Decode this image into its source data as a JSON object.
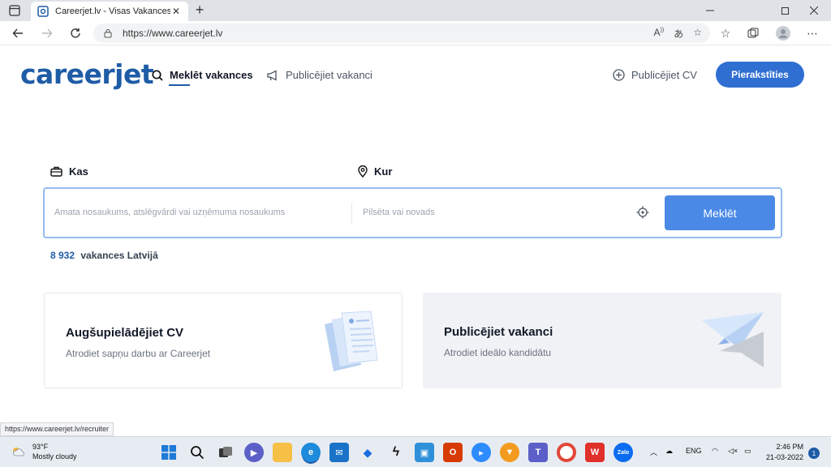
{
  "browser": {
    "tab_title": "Careerjet.lv - Visas Vakances Latvijā",
    "url": "https://www.careerjet.lv",
    "close_glyph": "✕",
    "newtab_glyph": "+"
  },
  "site": {
    "logo": "careerjet",
    "nav": {
      "search_jobs": "Meklēt vakances",
      "post_job": "Publicējiet vakanci",
      "post_cv": "Publicējiet CV",
      "signup": "Pierakstīties"
    },
    "search": {
      "what_label": "Kas",
      "where_label": "Kur",
      "what_placeholder": "Amata nosaukums, atslēgvārdi vai uzņēmuma nosaukums",
      "where_placeholder": "Pilsēta vai novads",
      "button": "Meklēt"
    },
    "count": {
      "number": "8 932",
      "text": "vakances Latvijā"
    },
    "cards": [
      {
        "title": "Augšupielādējiet CV",
        "subtitle": "Atrodiet sapņu darbu ar Careerjet"
      },
      {
        "title": "Publicējiet vakanci",
        "subtitle": "Atrodiet ideālo kandidātu"
      }
    ]
  },
  "status_url": "https://www.careerjet.lv/recruiter",
  "taskbar": {
    "temp": "93°F",
    "weather": "Mostly cloudy",
    "lang": "ENG",
    "time": "2:46 PM",
    "date": "21-03-2022",
    "notifications": "1"
  },
  "colors": {
    "brand": "#1f5ca6",
    "button": "#2f6fd2",
    "search_button": "#4a8ae6"
  }
}
